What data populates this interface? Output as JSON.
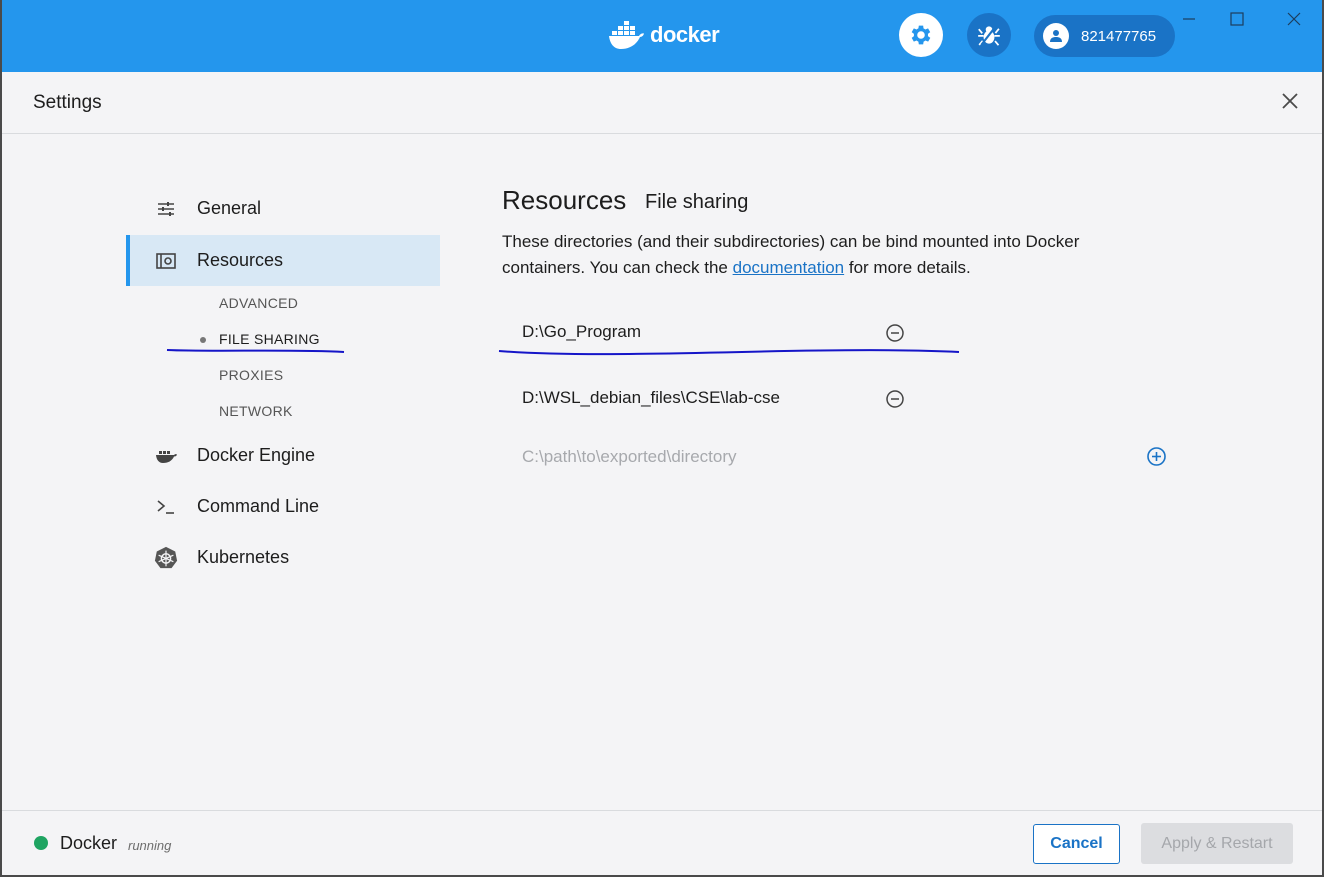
{
  "titlebar": {
    "brand": "docker",
    "account": "821477765",
    "colors": {
      "bar": "#2496ed",
      "accent": "#1a73c6"
    }
  },
  "settings": {
    "title": "Settings"
  },
  "sidebar": {
    "items": [
      {
        "label": "General",
        "icon": "sliders-icon"
      },
      {
        "label": "Resources",
        "icon": "resources-icon"
      },
      {
        "label": "Docker Engine",
        "icon": "whale-icon"
      },
      {
        "label": "Command Line",
        "icon": "terminal-icon"
      },
      {
        "label": "Kubernetes",
        "icon": "kubernetes-icon"
      }
    ],
    "sub_items": [
      "ADVANCED",
      "FILE SHARING",
      "PROXIES",
      "NETWORK"
    ]
  },
  "main": {
    "title": "Resources",
    "subtitle": "File sharing",
    "description_before": "These directories (and their subdirectories) can be bind mounted into Docker containers. You can check the ",
    "description_link": "documentation",
    "description_after": " for more details.",
    "directories": [
      "D:\\Go_Program",
      "D:\\WSL_debian_files\\CSE\\lab-cse"
    ],
    "new_directory_placeholder": "C:\\path\\to\\exported\\directory"
  },
  "footer": {
    "app_name": "Docker",
    "status": "running",
    "cancel_label": "Cancel",
    "apply_label": "Apply & Restart",
    "status_color": "#1fa462"
  }
}
